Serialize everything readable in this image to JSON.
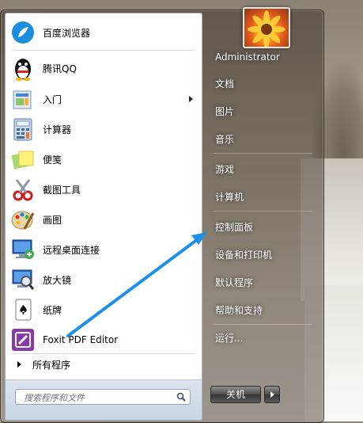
{
  "programs": [
    {
      "label": "百度浏览器",
      "icon": "baidu-browser-icon",
      "submenu": false
    },
    {
      "label": "腾讯QQ",
      "icon": "qq-penguin-icon",
      "submenu": false
    },
    {
      "label": "入门",
      "icon": "getting-started-icon",
      "submenu": true
    },
    {
      "label": "计算器",
      "icon": "calculator-icon",
      "submenu": false
    },
    {
      "label": "便笺",
      "icon": "sticky-notes-icon",
      "submenu": false
    },
    {
      "label": "截图工具",
      "icon": "snipping-tool-icon",
      "submenu": false
    },
    {
      "label": "画图",
      "icon": "paint-icon",
      "submenu": false
    },
    {
      "label": "远程桌面连接",
      "icon": "remote-desktop-icon",
      "submenu": false
    },
    {
      "label": "放大镜",
      "icon": "magnifier-icon",
      "submenu": false
    },
    {
      "label": "纸牌",
      "icon": "solitaire-icon",
      "submenu": false
    },
    {
      "label": "Foxit PDF Editor",
      "icon": "foxit-pdf-icon",
      "submenu": false
    }
  ],
  "all_programs": "所有程序",
  "search": {
    "placeholder": "搜索程序和文件"
  },
  "right": {
    "user": "Administrator",
    "documents": "文档",
    "pictures": "图片",
    "music": "音乐",
    "games": "游戏",
    "computer": "计算机",
    "control_panel": "控制面板",
    "devices": "设备和打印机",
    "defaults": "默认程序",
    "help": "帮助和支持",
    "run": "运行..."
  },
  "shutdown": {
    "label": "关机"
  },
  "colors": {
    "arrow": "#1e90e6",
    "menu_text": "#ffffff",
    "pane_border": "#a7b1be"
  }
}
